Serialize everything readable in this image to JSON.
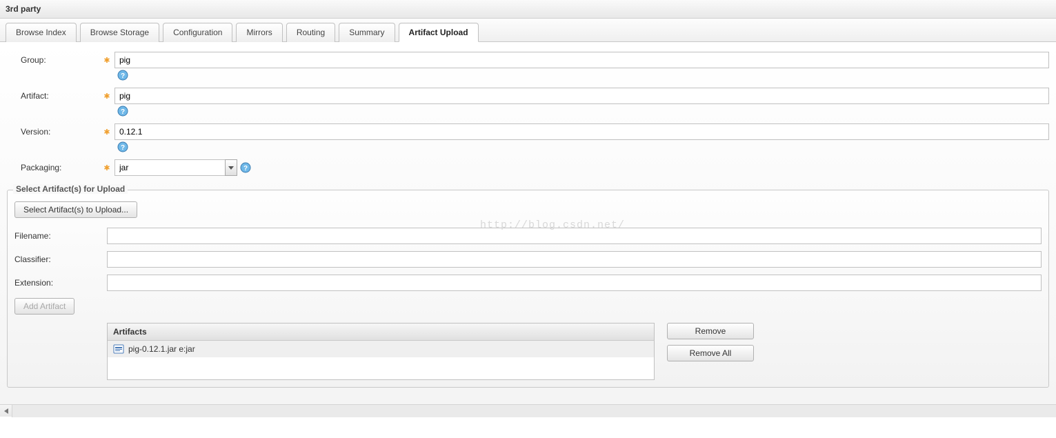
{
  "header": {
    "title": "3rd party"
  },
  "tabs": [
    {
      "label": "Browse Index",
      "active": false
    },
    {
      "label": "Browse Storage",
      "active": false
    },
    {
      "label": "Configuration",
      "active": false
    },
    {
      "label": "Mirrors",
      "active": false
    },
    {
      "label": "Routing",
      "active": false
    },
    {
      "label": "Summary",
      "active": false
    },
    {
      "label": "Artifact Upload",
      "active": true
    }
  ],
  "form": {
    "group": {
      "label": "Group:",
      "value": "pig"
    },
    "artifact": {
      "label": "Artifact:",
      "value": "pig"
    },
    "version": {
      "label": "Version:",
      "value": "0.12.1"
    },
    "packaging": {
      "label": "Packaging:",
      "value": "jar"
    }
  },
  "uploadSection": {
    "legend": "Select Artifact(s) for Upload",
    "selectButton": "Select Artifact(s) to Upload...",
    "filename": {
      "label": "Filename:",
      "value": ""
    },
    "classifier": {
      "label": "Classifier:",
      "value": ""
    },
    "extension": {
      "label": "Extension:",
      "value": ""
    },
    "addButton": "Add Artifact",
    "gridHeader": "Artifacts",
    "artifactRow": "pig-0.12.1.jar e:jar",
    "removeButton": "Remove",
    "removeAllButton": "Remove All"
  },
  "watermark": "http://blog.csdn.net/"
}
